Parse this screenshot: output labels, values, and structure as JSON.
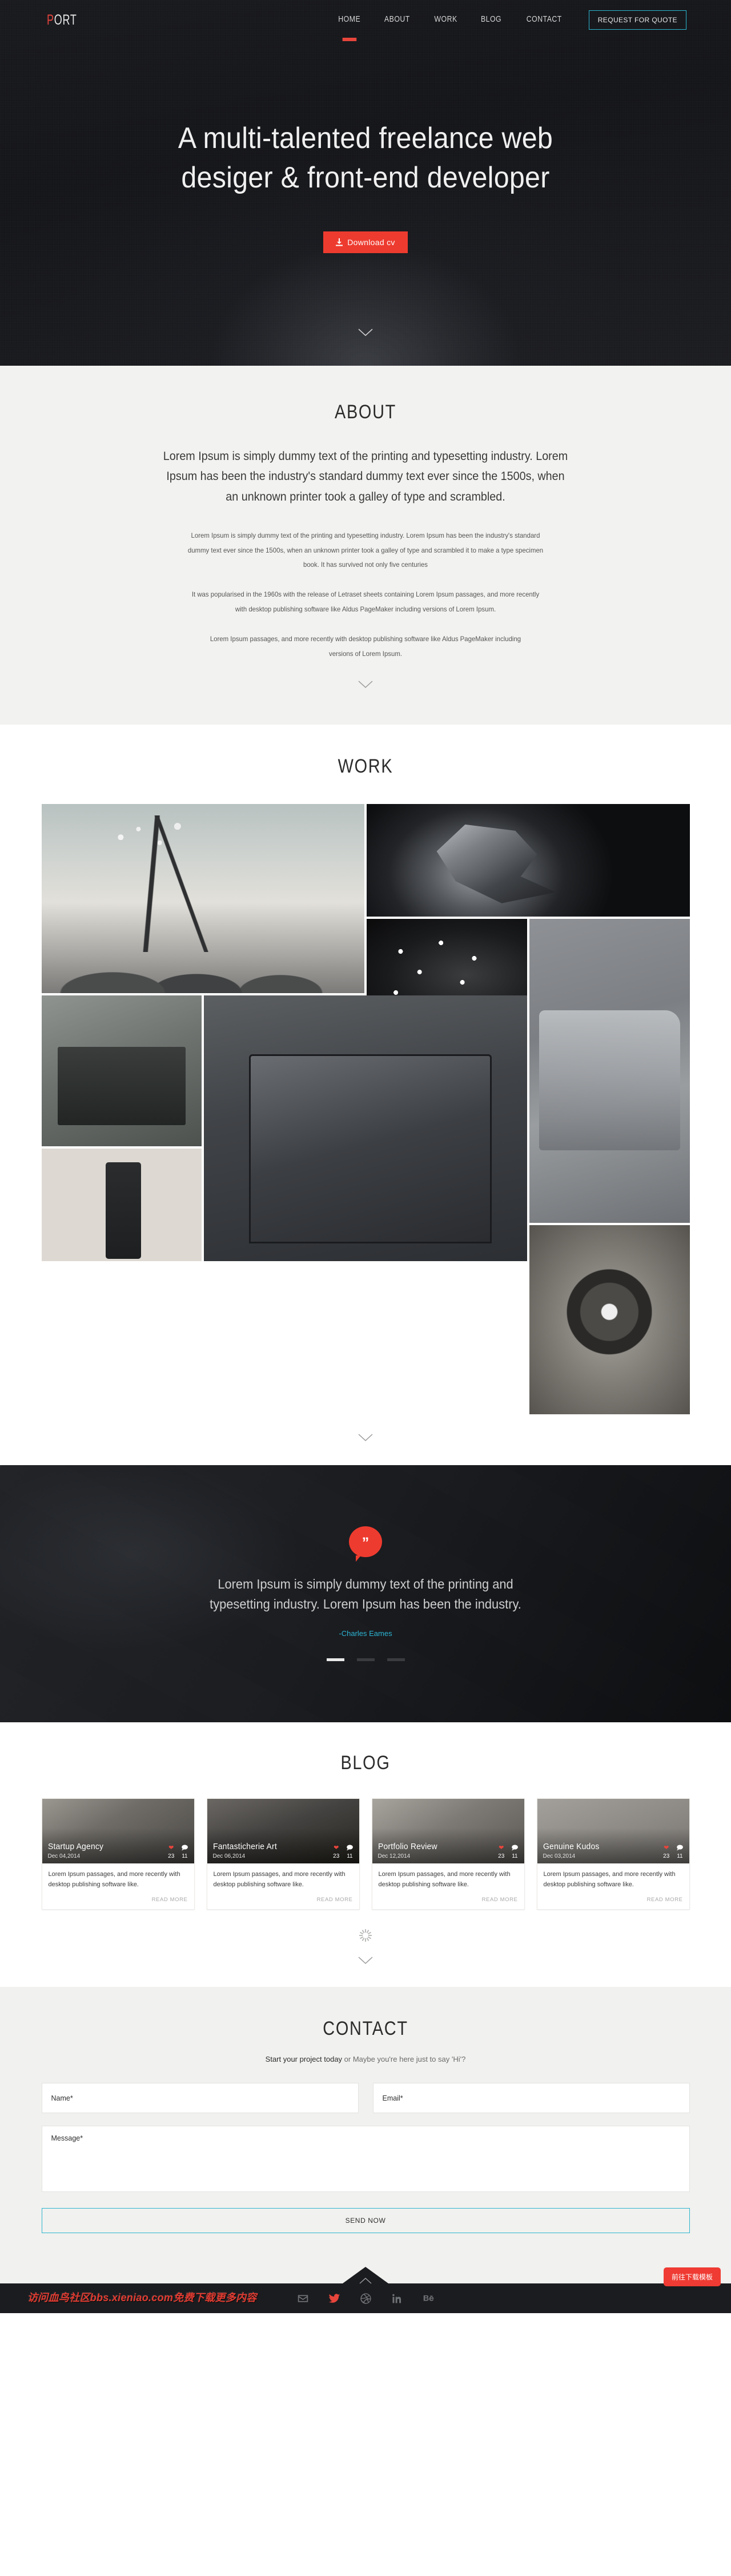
{
  "brand": {
    "name_accent": "P",
    "name_rest": "ORT"
  },
  "nav": {
    "items": [
      {
        "label": "HOME",
        "active": true
      },
      {
        "label": "ABOUT",
        "active": false
      },
      {
        "label": "WORK",
        "active": false
      },
      {
        "label": "BLOG",
        "active": false
      },
      {
        "label": "CONTACT",
        "active": false
      }
    ],
    "cta": "REQUEST FOR QUOTE"
  },
  "hero": {
    "title_line1": "A multi-talented freelance web",
    "title_line2": "desiger & front-end developer",
    "cta": "Download cv"
  },
  "about": {
    "title": "ABOUT",
    "lead": "Lorem Ipsum is simply dummy text of the printing and typesetting industry. Lorem Ipsum has been the industry's standard dummy text ever since the 1500s, when an unknown printer took a galley of type and scrambled.",
    "p1": "Lorem Ipsum is simply dummy text of the printing and typesetting industry. Lorem Ipsum has been the industry's standard dummy text ever since the 1500s, when an unknown printer took a galley of type and scrambled it to make a type specimen book. It has survived not only five centuries",
    "p2": "It was popularised in the 1960s with the release of Letraset sheets containing Lorem Ipsum passages, and more recently with desktop publishing software like Aldus PageMaker including versions of Lorem Ipsum.",
    "p3": "Lorem Ipsum passages, and more recently with desktop publishing software like Aldus PageMaker including versions of Lorem Ipsum."
  },
  "work": {
    "title": "WORK",
    "tiles": [
      {
        "name": "illustration-landscape"
      },
      {
        "name": "bird-sculpture"
      },
      {
        "name": "network-portrait"
      },
      {
        "name": "car-transport"
      },
      {
        "name": "discovery-channel-africa"
      },
      {
        "name": "book-a-whole-home"
      },
      {
        "name": "google-calendar-phone"
      },
      {
        "name": "world-of-warcraft"
      }
    ]
  },
  "testimonial": {
    "quote": "Lorem Ipsum is simply dummy text of the printing and typesetting industry. Lorem Ipsum has been the industry.",
    "author": "-Charles Eames",
    "slides": 3,
    "active_slide": 1,
    "accent": "#ee3b2f",
    "author_color": "#2cb5d4"
  },
  "blog": {
    "title": "BLOG",
    "read_more": "READ MORE",
    "posts": [
      {
        "title": "Startup Agency",
        "date": "Dec 04,2014",
        "likes": "23",
        "comments": "11",
        "excerpt": "Lorem Ipsum passages, and more recently with desktop publishing software like."
      },
      {
        "title": "Fantasticherie Art",
        "date": "Dec 06,2014",
        "likes": "23",
        "comments": "11",
        "excerpt": "Lorem Ipsum passages, and more recently with desktop publishing software like."
      },
      {
        "title": "Portfolio Review",
        "date": "Dec 12,2014",
        "likes": "23",
        "comments": "11",
        "excerpt": "Lorem Ipsum passages, and more recently with desktop publishing software like."
      },
      {
        "title": "Genuine Kudos",
        "date": "Dec 03,2014",
        "likes": "23",
        "comments": "11",
        "excerpt": "Lorem Ipsum passages, and more recently with desktop publishing software like."
      }
    ]
  },
  "contact": {
    "title": "CONTACT",
    "sub_strong": "Start your project today",
    "sub_rest": " or Maybe you're here just to say 'Hi'?",
    "name_placeholder": "Name*",
    "email_placeholder": "Email*",
    "message_placeholder": "Message*",
    "send_label": "SEND NOW",
    "accent_border": "#2bb6cf"
  },
  "footer": {
    "socials": [
      "envelope-icon",
      "twitter-icon",
      "dribbble-icon",
      "linkedin-icon",
      "behance-icon"
    ],
    "watermark": "访问血鸟社区bbs.xieniao.com免费下载更多内容",
    "download_template": "前往下载模板"
  },
  "colors": {
    "red": "#ee3b2f",
    "cyan": "#2bb6cf",
    "dark": "#1b1c1f",
    "light": "#f2f2f0"
  }
}
